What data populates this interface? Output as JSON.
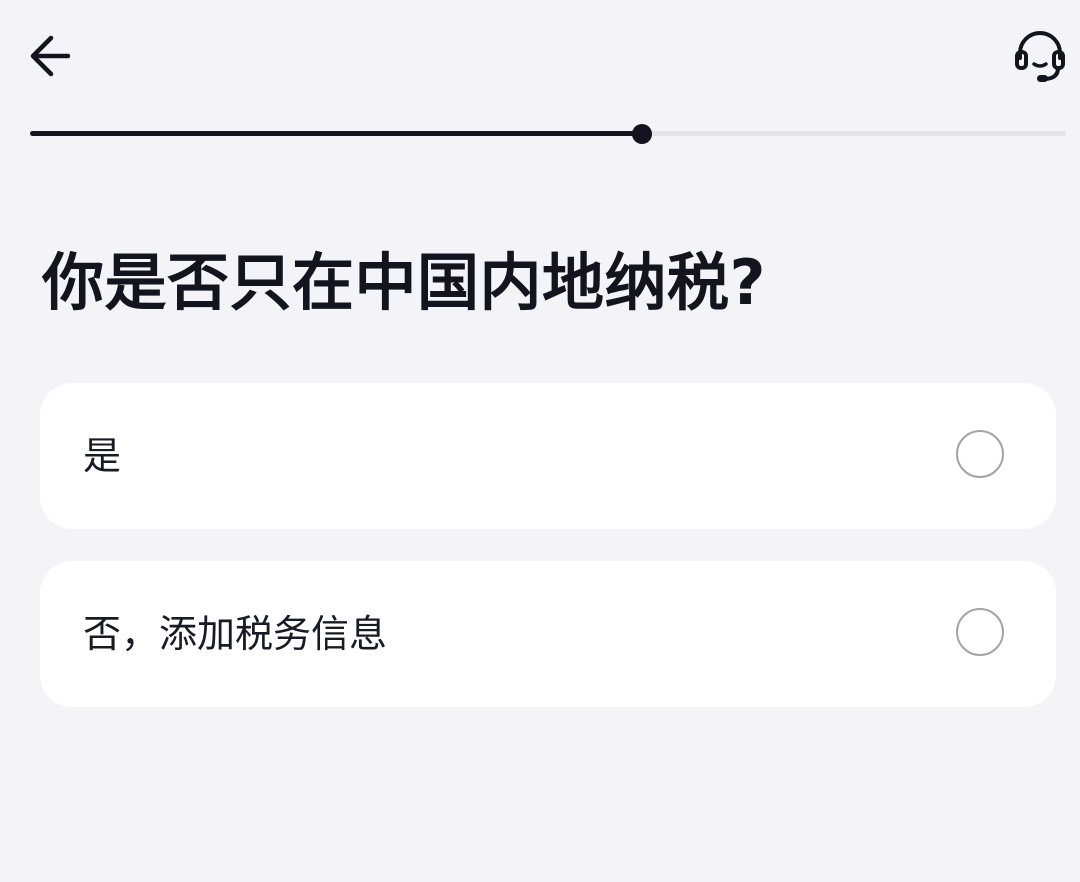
{
  "header": {
    "back_icon": "arrow-left-icon",
    "support_icon": "headset-icon"
  },
  "progress": {
    "fraction": 0.591
  },
  "question": {
    "title": "你是否只在中国内地纳税?"
  },
  "options": [
    {
      "label": "是",
      "selected": false
    },
    {
      "label": "否，添加税务信息",
      "selected": false
    }
  ],
  "colors": {
    "background": "#F4F4F8",
    "card": "#FFFFFF",
    "text": "#14141F",
    "progress_fill": "#14141F",
    "progress_track": "#E3E3E8",
    "radio_border": "#A3A3A8"
  }
}
